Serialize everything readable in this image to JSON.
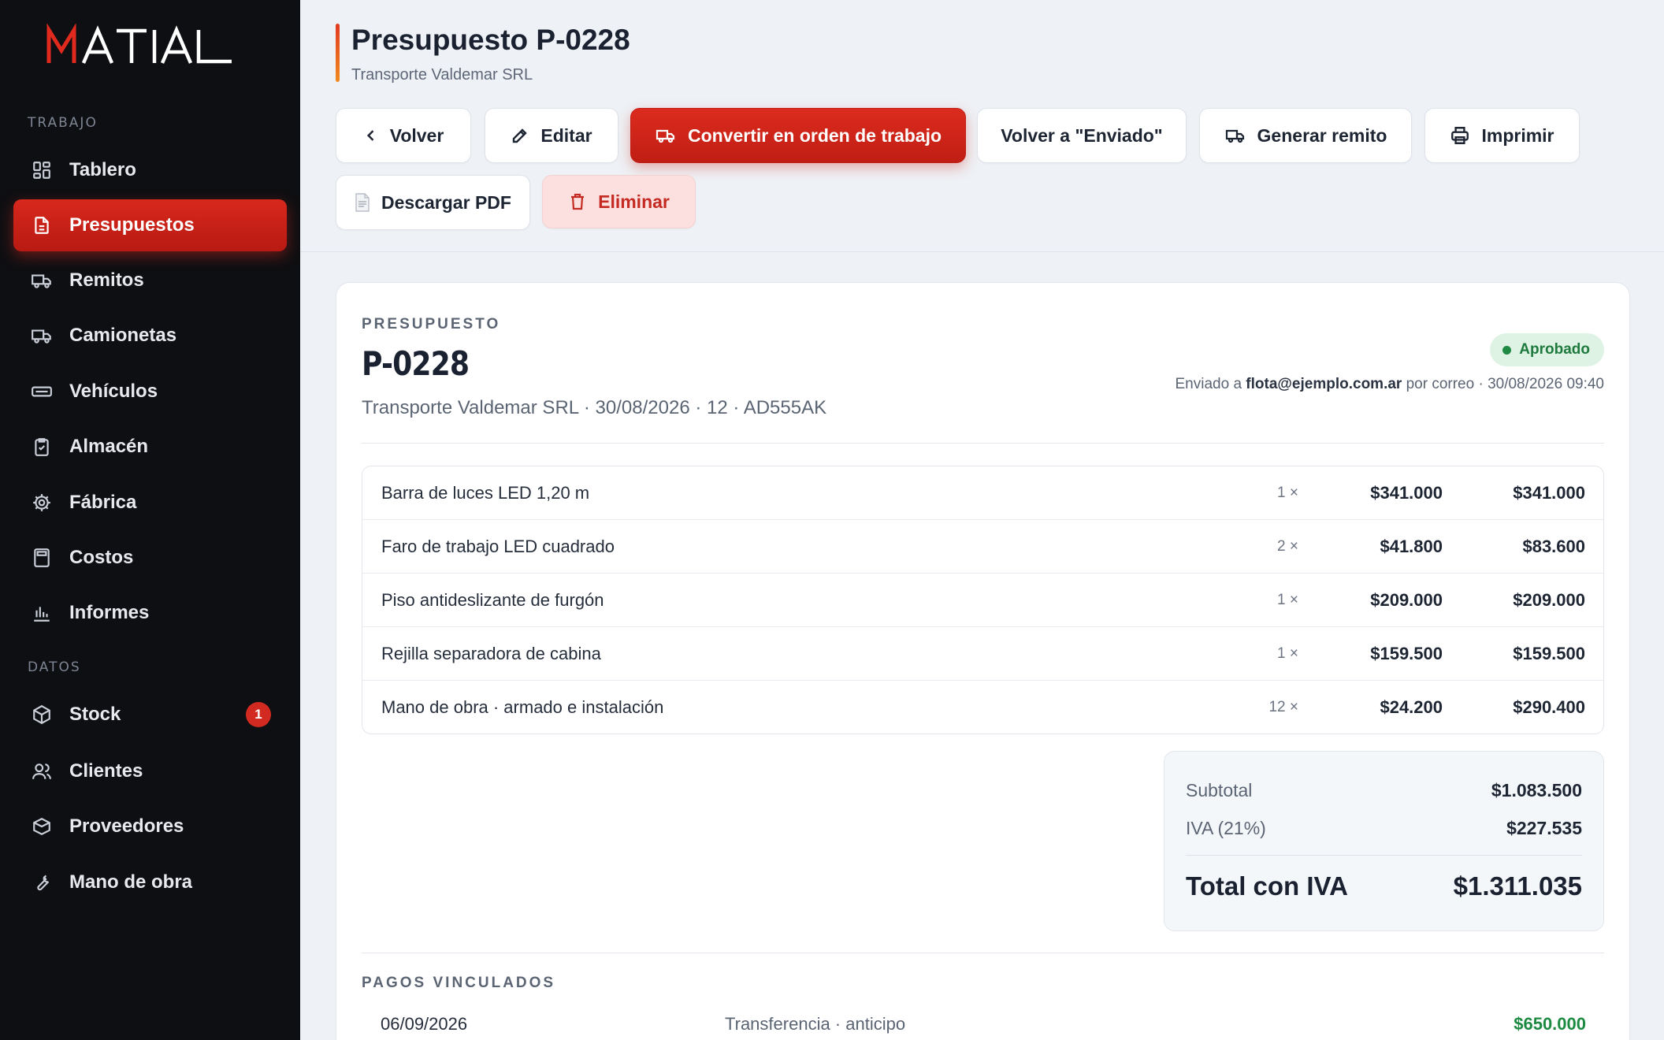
{
  "brand": {
    "logo_text": "MATIAL",
    "accent_color": "#e02a1e"
  },
  "sidebar": {
    "sections": [
      {
        "label": "TRABAJO"
      },
      {
        "label": "DATOS"
      }
    ],
    "items": [
      {
        "label": "Tablero",
        "icon": "dashboard-icon"
      },
      {
        "label": "Presupuestos",
        "icon": "document-icon",
        "active": true
      },
      {
        "label": "Remitos",
        "icon": "truck-icon"
      },
      {
        "label": "Camionetas",
        "icon": "van-icon"
      },
      {
        "label": "Vehículos",
        "icon": "vehicle-icon"
      },
      {
        "label": "Almacén",
        "icon": "clipboard-icon"
      },
      {
        "label": "Fábrica",
        "icon": "gear-icon"
      },
      {
        "label": "Costos",
        "icon": "calculator-icon"
      },
      {
        "label": "Informes",
        "icon": "bar-chart-icon"
      },
      {
        "label": "Stock",
        "icon": "box-icon",
        "badge": "1"
      },
      {
        "label": "Clientes",
        "icon": "users-icon"
      },
      {
        "label": "Proveedores",
        "icon": "package-icon"
      },
      {
        "label": "Mano de obra",
        "icon": "wrench-icon"
      }
    ]
  },
  "header": {
    "title": "Presupuesto P-0228",
    "subtitle": "Transporte Valdemar SRL",
    "buttons": {
      "back": "Volver",
      "edit": "Editar",
      "convert": "Convertir en orden de trabajo",
      "revert": "Volver a \"Enviado\"",
      "remito": "Generar remito",
      "print": "Imprimir",
      "pdf": "Descargar PDF",
      "delete": "Eliminar"
    }
  },
  "quote": {
    "kicker": "PRESUPUESTO",
    "number": "P-0228",
    "meta": "Transporte Valdemar SRL · 30/08/2026 · 12 · AD555AK",
    "status": "Aprobado",
    "status_color": "#1f8a43",
    "sent_prefix": "Enviado a ",
    "sent_email": "flota@ejemplo.com.ar",
    "sent_suffix": " por correo · 30/08/2026 09:40",
    "items": [
      {
        "desc": "Barra de luces LED 1,20 m",
        "qty": "1 ×",
        "unit": "$341.000",
        "total": "$341.000"
      },
      {
        "desc": "Faro de trabajo LED cuadrado",
        "qty": "2 ×",
        "unit": "$41.800",
        "total": "$83.600"
      },
      {
        "desc": "Piso antideslizante de furgón",
        "qty": "1 ×",
        "unit": "$209.000",
        "total": "$209.000"
      },
      {
        "desc": "Rejilla separadora de cabina",
        "qty": "1 ×",
        "unit": "$159.500",
        "total": "$159.500"
      },
      {
        "desc": "Mano de obra · armado e instalación",
        "qty": "12 ×",
        "unit": "$24.200",
        "total": "$290.400"
      }
    ],
    "totals": {
      "subtotal_label": "Subtotal",
      "subtotal": "$1.083.500",
      "iva_label": "IVA (21%)",
      "iva": "$227.535",
      "grand_label": "Total con IVA",
      "grand": "$1.311.035"
    },
    "payments_label": "PAGOS VINCULADOS",
    "payments": [
      {
        "date": "06/09/2026",
        "method": "Transferencia · anticipo",
        "amount": "$650.000"
      }
    ]
  }
}
